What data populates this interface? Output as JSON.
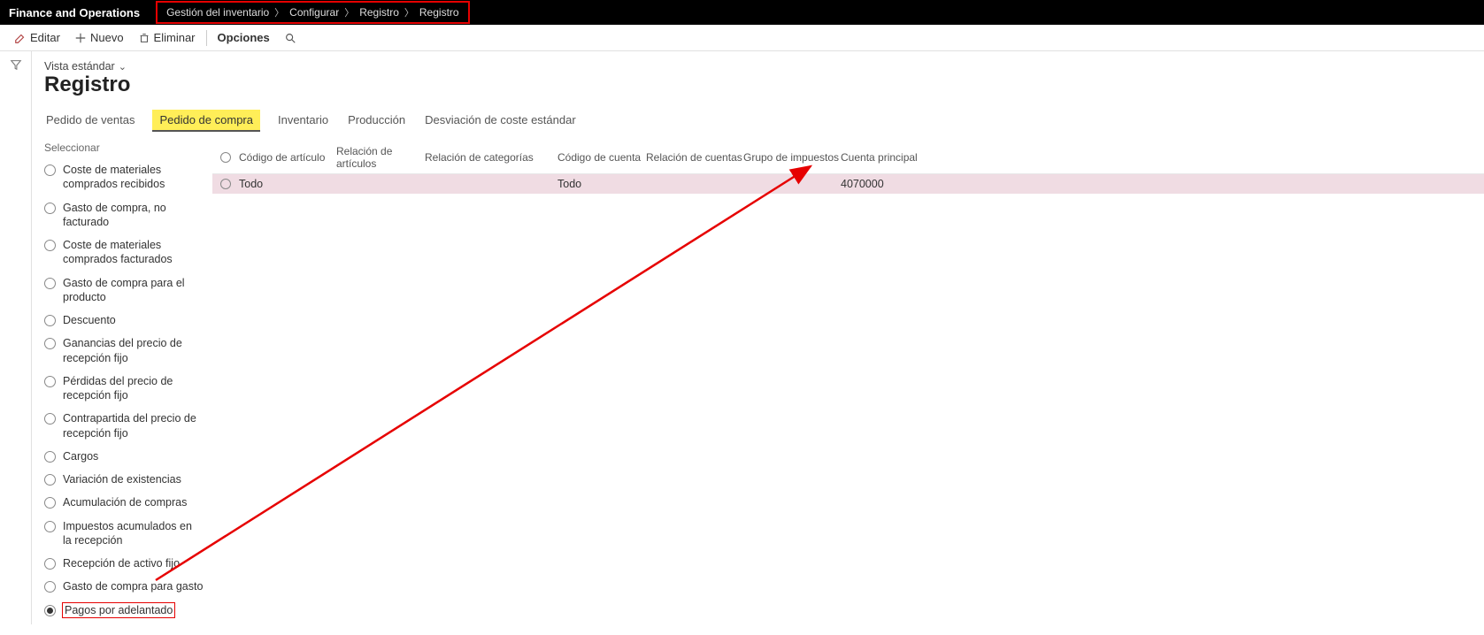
{
  "app_title": "Finance and Operations",
  "breadcrumb": [
    "Gestión del inventario",
    "Configurar",
    "Registro",
    "Registro"
  ],
  "actions": {
    "edit": "Editar",
    "new": "Nuevo",
    "delete": "Eliminar",
    "options": "Opciones"
  },
  "view_label": "Vista estándar",
  "page_title": "Registro",
  "tabs": [
    "Pedido de ventas",
    "Pedido de compra",
    "Inventario",
    "Producción",
    "Desviación de coste estándar"
  ],
  "active_tab_index": 1,
  "select_label": "Seleccionar",
  "select_items": [
    "Coste de materiales comprados recibidos",
    "Gasto de compra, no facturado",
    "Coste de materiales comprados facturados",
    "Gasto de compra para el producto",
    "Descuento",
    "Ganancias del precio de recepción fijo",
    "Pérdidas del precio de recepción fijo",
    "Contrapartida del precio de recepción fijo",
    "Cargos",
    "Variación de existencias",
    "Acumulación de compras",
    "Impuestos acumulados en la recepción",
    "Recepción de activo fijo",
    "Gasto de compra para gasto",
    "Pagos por adelantado"
  ],
  "selected_item_index": 14,
  "grid": {
    "columns": [
      "Código de artículo",
      "Relación de artículos",
      "Relación de categorías",
      "Código de cuenta",
      "Relación de cuentas",
      "Grupo de impuestos",
      "Cuenta principal"
    ],
    "rows": [
      {
        "codigo_articulo": "Todo",
        "rel_articulos": "",
        "rel_categorias": "",
        "codigo_cuenta": "Todo",
        "rel_cuentas": "",
        "grupo_impuestos": "",
        "cuenta_principal": "4070000"
      }
    ]
  }
}
